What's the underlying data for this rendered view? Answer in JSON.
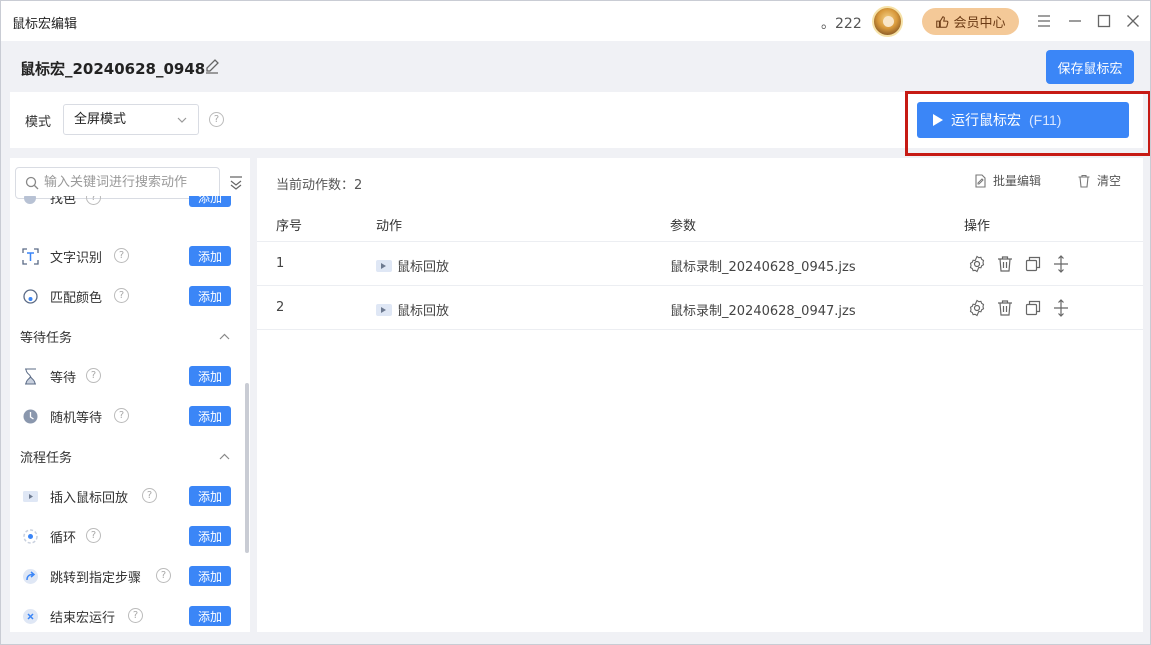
{
  "window": {
    "title": "鼠标宏编辑",
    "points": "。222",
    "vip_label": "会员中心"
  },
  "header": {
    "macro_name": "鼠标宏_20240628_0948",
    "save_label": "保存鼠标宏"
  },
  "mode": {
    "label": "模式",
    "selected": "全屏模式",
    "help": "?"
  },
  "run": {
    "label": "运行鼠标宏",
    "shortcut": "(F11)"
  },
  "sidebar": {
    "search_placeholder": "输入关键词进行搜索动作",
    "add_label": "添加",
    "items_top": [
      {
        "label": "找色"
      },
      {
        "label": "文字识别"
      },
      {
        "label": "匹配颜色"
      }
    ],
    "section_wait": "等待任务",
    "items_wait": [
      {
        "label": "等待"
      },
      {
        "label": "随机等待"
      }
    ],
    "section_flow": "流程任务",
    "items_flow": [
      {
        "label": "插入鼠标回放"
      },
      {
        "label": "循环"
      },
      {
        "label": "跳转到指定步骤"
      },
      {
        "label": "结束宏运行"
      }
    ]
  },
  "main": {
    "count_text": "当前动作数：2",
    "batch_label": "批量编辑",
    "clear_label": "清空",
    "columns": [
      "序号",
      "动作",
      "参数",
      "操作"
    ],
    "rows": [
      {
        "index": "1",
        "action": "鼠标回放",
        "param": "鼠标录制_20240628_0945.jzs"
      },
      {
        "index": "2",
        "action": "鼠标回放",
        "param": "鼠标录制_20240628_0947.jzs"
      }
    ]
  },
  "colors": {
    "accent": "#3b86f7",
    "vip": "#f4c998",
    "highlight_frame": "#c61a14"
  }
}
